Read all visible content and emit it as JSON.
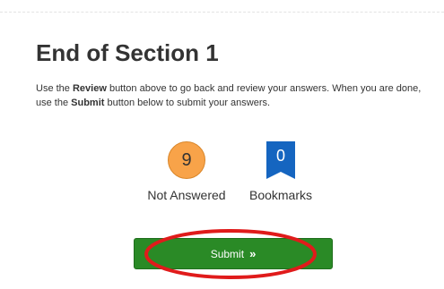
{
  "section": {
    "title": "End of Section 1",
    "instructions": {
      "part1": "Use the ",
      "review": "Review",
      "part2": " button above to go back and review your answers. When you are done, use the ",
      "submit": "Submit",
      "part3": " button below to submit your answers."
    }
  },
  "stats": {
    "not_answered": {
      "count": "9",
      "label": "Not Answered",
      "color": "#f8a349"
    },
    "bookmarks": {
      "count": "0",
      "label": "Bookmarks",
      "color": "#1565c0"
    }
  },
  "submit_button": {
    "label": "Submit",
    "icon": "double-chevron-right-icon",
    "glyph": "»",
    "color": "#2a8a26"
  },
  "annotation": {
    "color": "#e01b1b"
  }
}
